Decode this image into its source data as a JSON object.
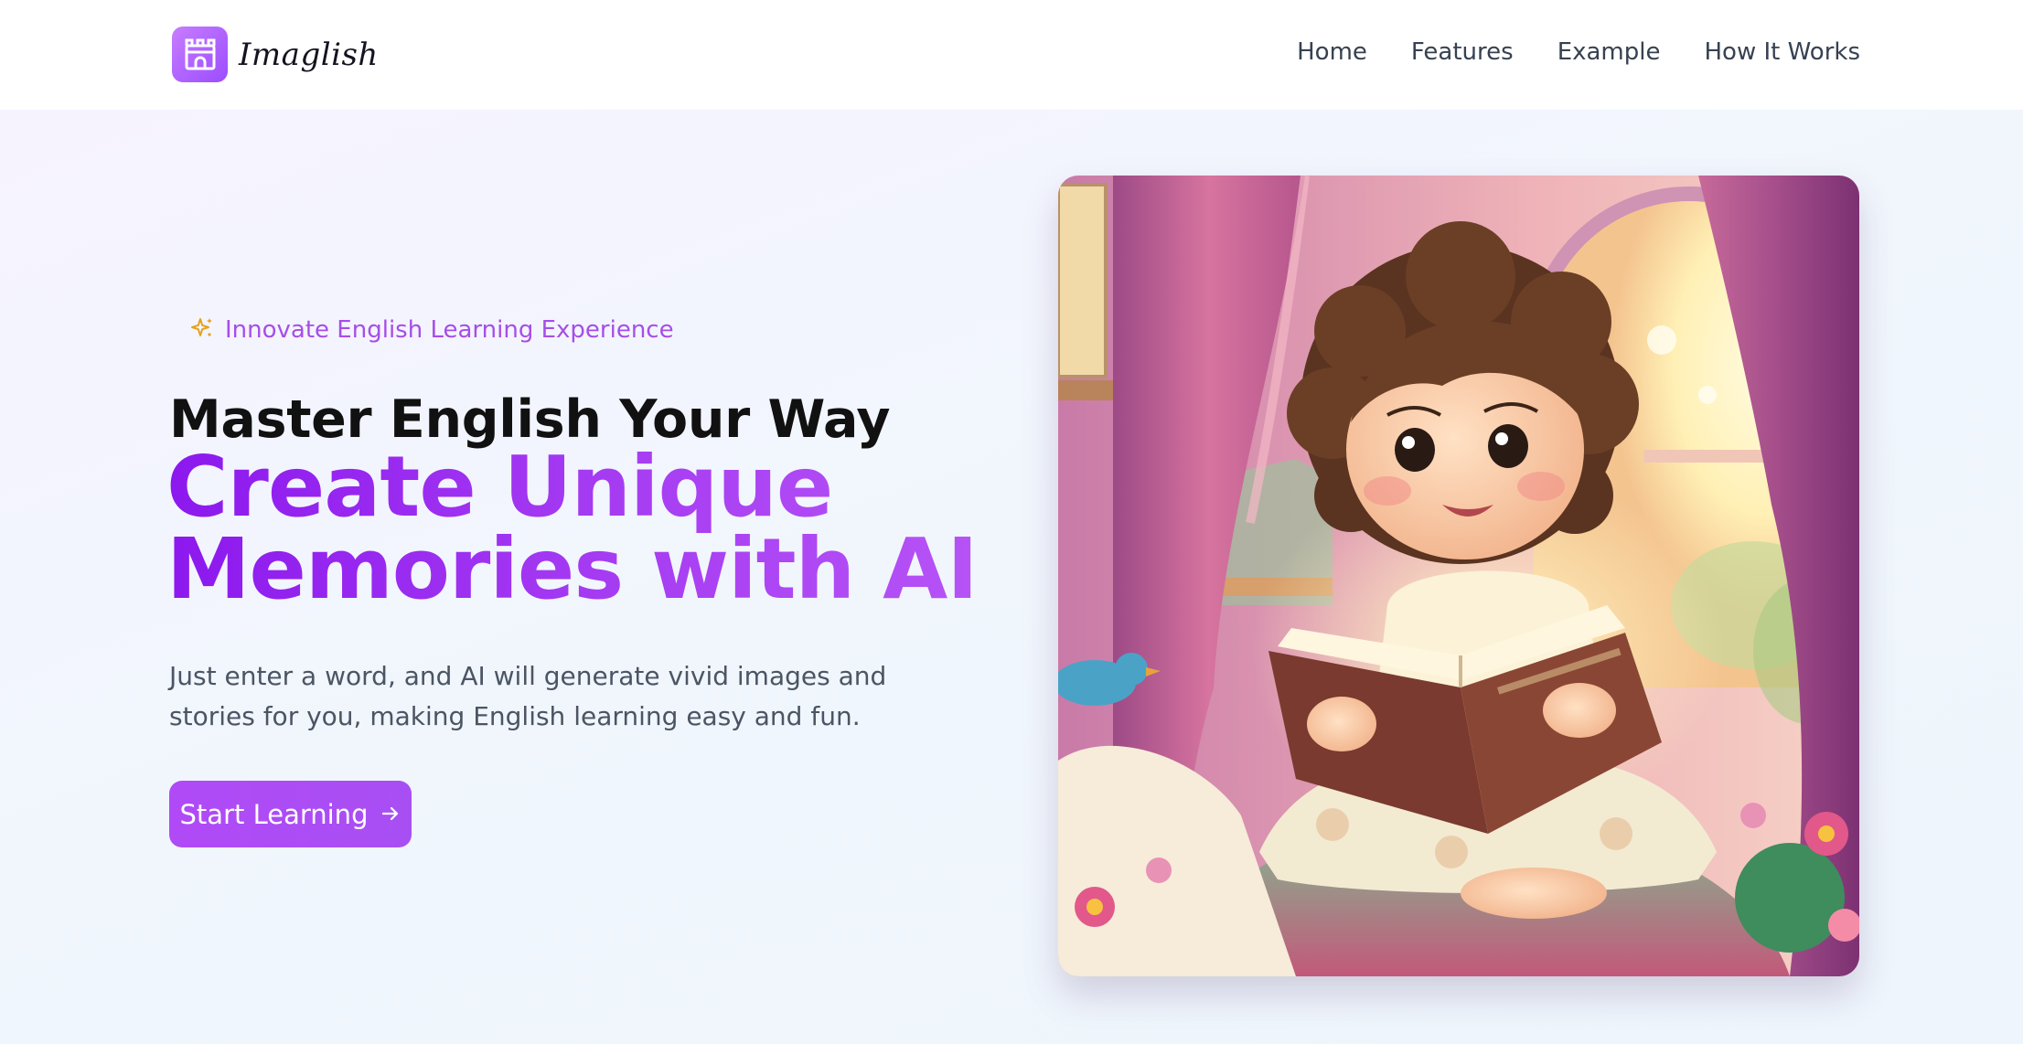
{
  "header": {
    "brand_name": "Imaglish",
    "logo_icon": "castle-icon",
    "nav": [
      {
        "label": "Home"
      },
      {
        "label": "Features"
      },
      {
        "label": "Example"
      },
      {
        "label": "How It Works"
      }
    ]
  },
  "hero": {
    "tagline_icon": "sparkle-icon",
    "tagline": "Innovate English Learning Experience",
    "title_line1": "Master English Your Way",
    "title_line2a": "Create Unique",
    "title_line2b": "Memories with AI",
    "description": "Just enter a word, and AI will generate vivid images and stories for you, making English learning easy and fun.",
    "cta_label": "Start Learning",
    "cta_icon": "arrow-right-icon",
    "image_alt": ""
  },
  "colors": {
    "accent": "#a64ee8",
    "title_gradient_start": "#8c18ee",
    "title_gradient_end": "#b653f6",
    "button": "#ad4cf5",
    "background": "#f1f6fd"
  }
}
